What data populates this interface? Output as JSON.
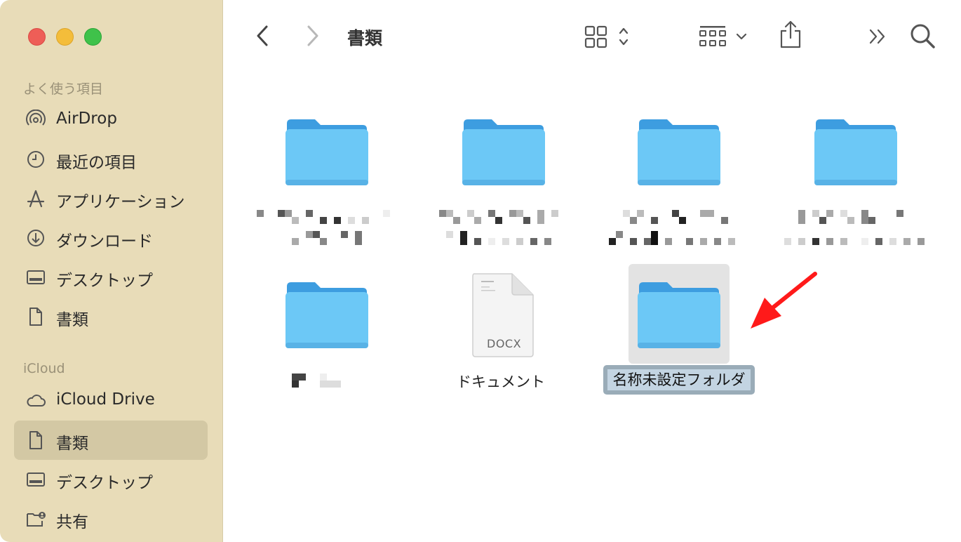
{
  "toolbar": {
    "title": "書類",
    "back_icon": "chevron-left-icon",
    "forward_icon": "chevron-right-icon",
    "view_icon": "grid-view-icon",
    "group_icon": "group-by-icon",
    "share_icon": "share-icon",
    "more_icon": "double-chevron-icon",
    "search_icon": "search-icon"
  },
  "sidebar": {
    "favorites_header": "よく使う項目",
    "favorites": [
      {
        "label": "AirDrop",
        "icon": "airdrop-icon"
      },
      {
        "label": "最近の項目",
        "icon": "clock-icon"
      },
      {
        "label": "アプリケーション",
        "icon": "applications-icon"
      },
      {
        "label": "ダウンロード",
        "icon": "download-icon"
      },
      {
        "label": "デスクトップ",
        "icon": "desktop-icon"
      },
      {
        "label": "書類",
        "icon": "document-icon"
      }
    ],
    "icloud_header": "iCloud",
    "icloud": [
      {
        "label": "iCloud Drive",
        "icon": "cloud-icon"
      },
      {
        "label": "書類",
        "icon": "document-icon",
        "selected": true
      },
      {
        "label": "デスクトップ",
        "icon": "desktop-icon"
      },
      {
        "label": "共有",
        "icon": "shared-folder-icon"
      }
    ]
  },
  "files": [
    {
      "type": "folder",
      "label_hidden": true
    },
    {
      "type": "folder",
      "label_hidden": true
    },
    {
      "type": "folder",
      "label_hidden": true
    },
    {
      "type": "folder",
      "label_hidden": true
    },
    {
      "type": "folder",
      "label_hidden": true
    },
    {
      "type": "docx",
      "label": "ドキュメント",
      "badge": "DOCX"
    },
    {
      "type": "folder",
      "label": "名称未設定フォルダ",
      "renaming": true
    }
  ],
  "colors": {
    "sidebar_bg": "#e8dcb8",
    "folder_blue": "#6cc4f4",
    "folder_tab": "#3d9de0",
    "annotation_arrow": "#ff1a1a"
  }
}
